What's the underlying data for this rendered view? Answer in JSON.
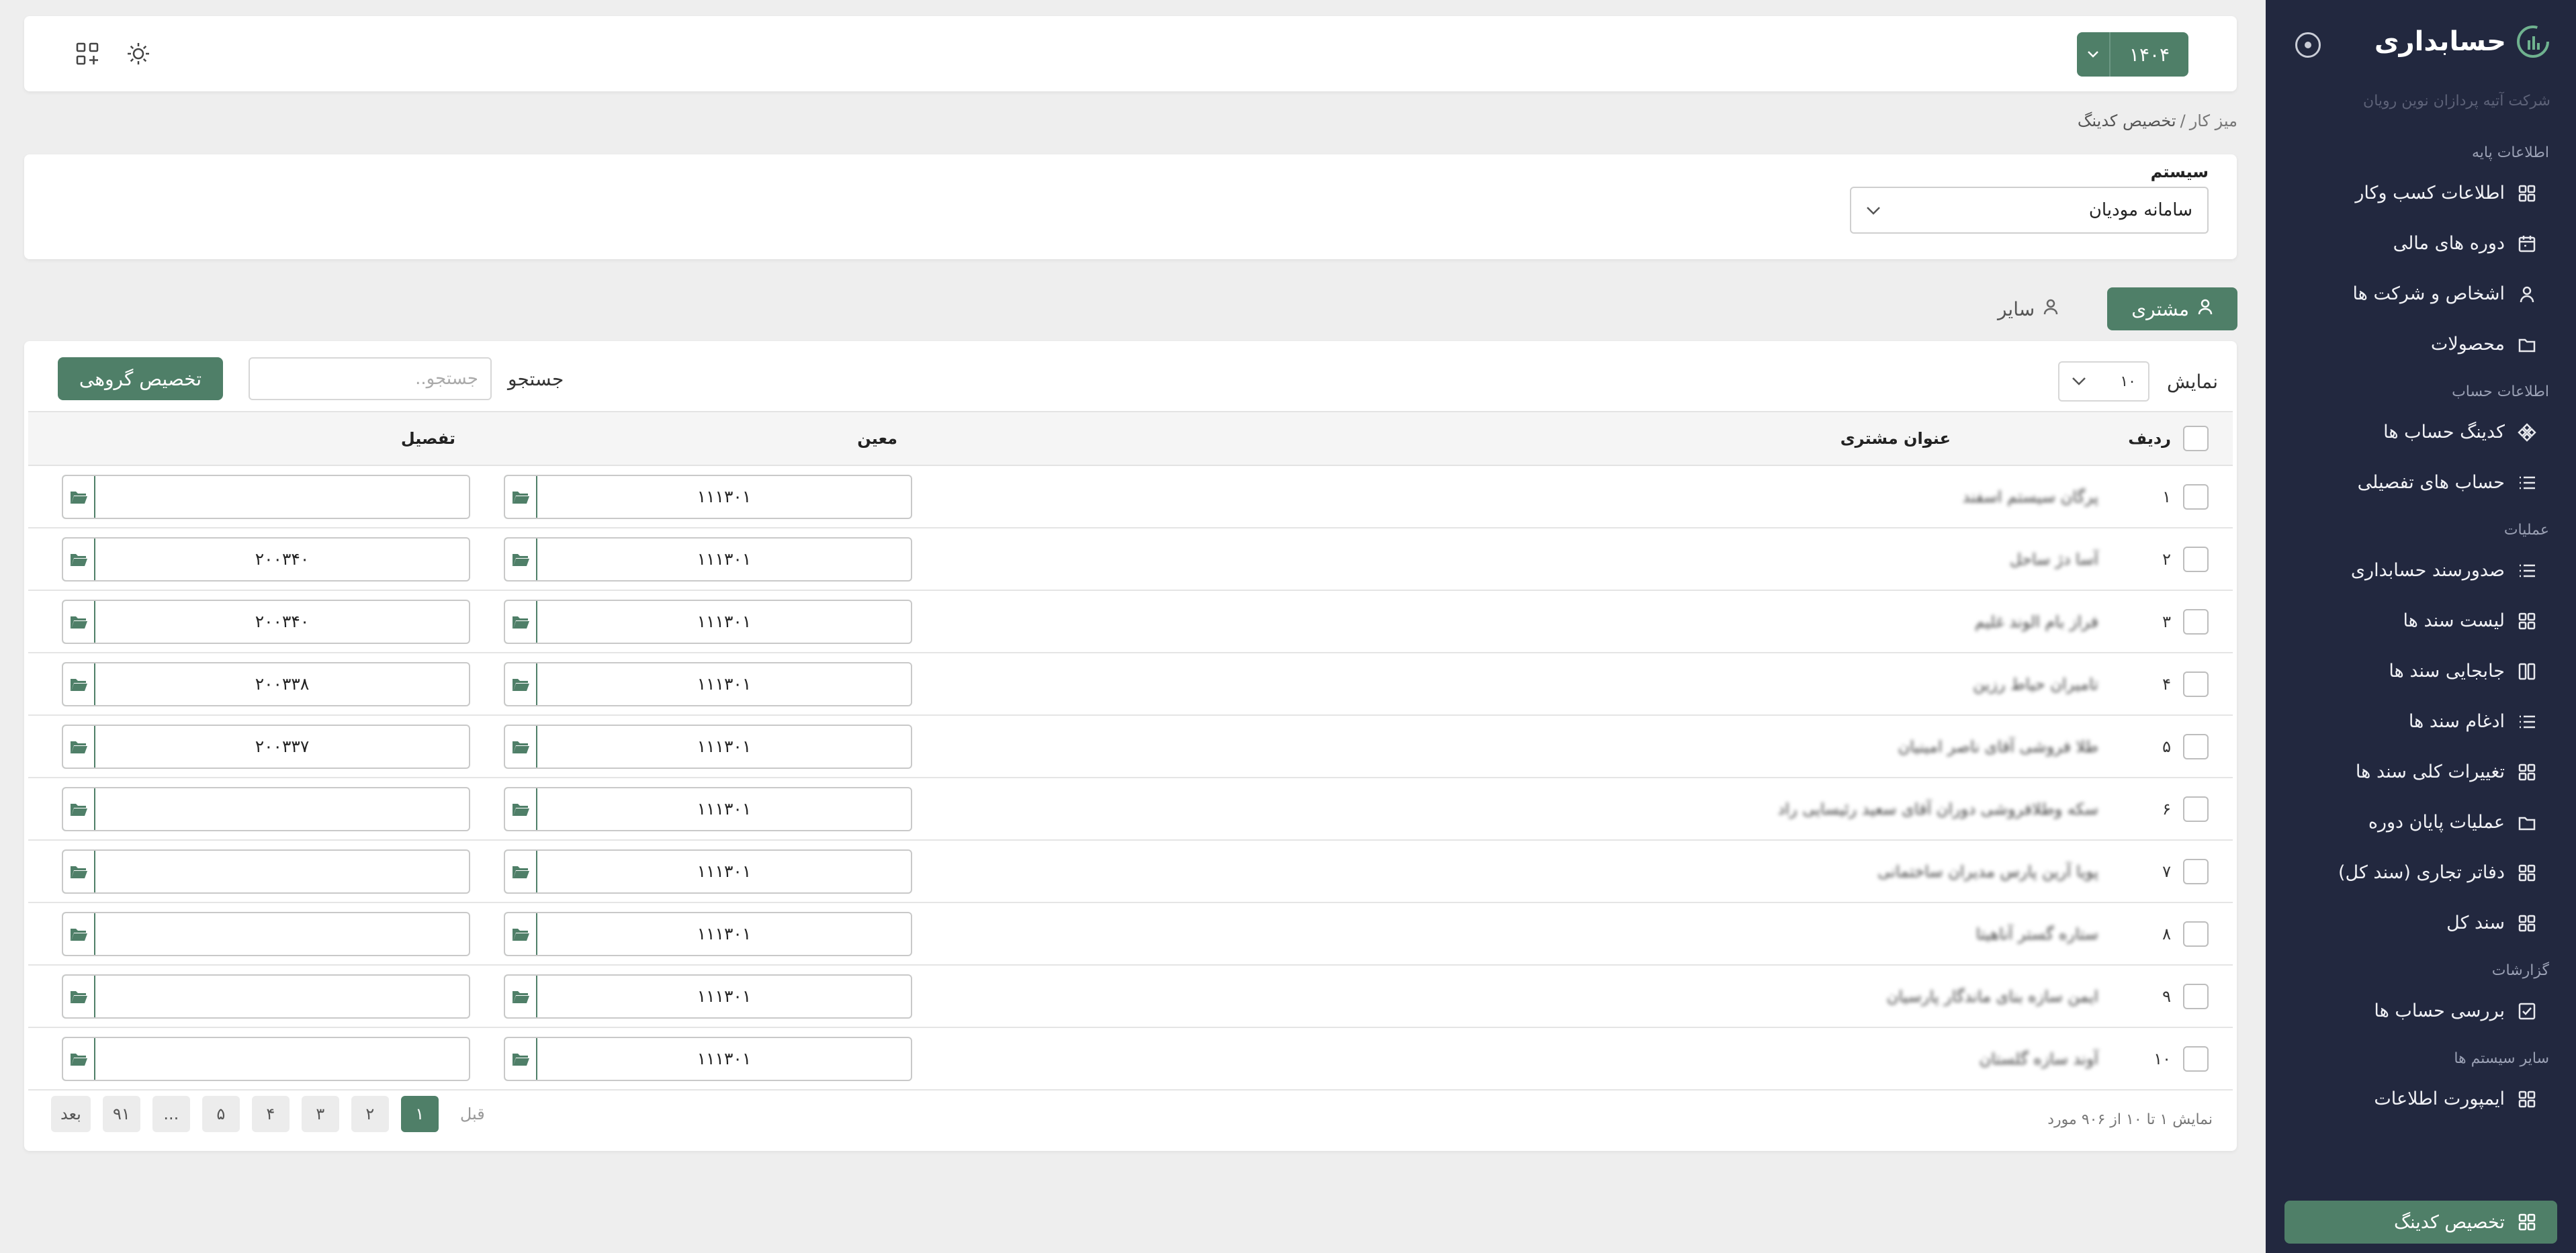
{
  "sidebar": {
    "title": "حسابداری",
    "company": "شرکت آتیه پردازان نوین رویان",
    "sections": [
      {
        "title": "اطلاعات پایه",
        "items": [
          {
            "label": "اطلاعات کسب وکار",
            "icon": "grid-icon"
          },
          {
            "label": "دوره های مالی",
            "icon": "calendar-icon"
          },
          {
            "label": "اشخاص و شرکت ها",
            "icon": "user-icon"
          },
          {
            "label": "محصولات",
            "icon": "folder-icon"
          }
        ]
      },
      {
        "title": "اطلاعات حساب",
        "items": [
          {
            "label": "کدینگ حساب ها",
            "icon": "diamond-icon"
          },
          {
            "label": "حساب های تفصیلی",
            "icon": "list-icon"
          }
        ]
      },
      {
        "title": "عملیات",
        "items": [
          {
            "label": "صدورسند حسابداری",
            "icon": "list-icon"
          },
          {
            "label": "لیست سند ها",
            "icon": "grid-icon"
          },
          {
            "label": "جابجایی سند ها",
            "icon": "columns-icon"
          },
          {
            "label": "ادغام سند ها",
            "icon": "list-icon"
          },
          {
            "label": "تغییرات کلی سند ها",
            "icon": "grid-icon"
          },
          {
            "label": "عملیات پایان دوره",
            "icon": "folder-icon"
          },
          {
            "label": "دفاتر تجاری (سند کل)",
            "icon": "grid-icon"
          },
          {
            "label": "سند کل",
            "icon": "grid-icon"
          }
        ]
      },
      {
        "title": "گزارشات",
        "items": [
          {
            "label": "بررسی حساب ها",
            "icon": "checkbox-icon"
          }
        ]
      },
      {
        "title": "سایر سیستم ها",
        "items": [
          {
            "label": "ایمپورت اطلاعات",
            "icon": "grid-icon"
          }
        ]
      }
    ],
    "active_item": {
      "label": "تخصیص کدینگ",
      "icon": "grid-icon"
    }
  },
  "topbar": {
    "year": "۱۴۰۴"
  },
  "breadcrumb": {
    "home": "میز کار",
    "separator": "/",
    "current": "تخصیص کدینگ"
  },
  "system": {
    "label": "سیستم",
    "value": "سامانه مودیان"
  },
  "tabs": [
    {
      "label": "مشتری",
      "active": true
    },
    {
      "label": "سایر",
      "active": false
    }
  ],
  "toolbar": {
    "show_label": "نمایش",
    "page_size": "۱۰",
    "search_label": "جستجو",
    "search_placeholder": "جستجو..",
    "group_assign": "تخصیص گروهی"
  },
  "table": {
    "headers": {
      "row": "ردیف",
      "title": "عنوان مشتری",
      "moein": "معین",
      "tafsil": "تفصیل"
    },
    "rows": [
      {
        "row": "۱",
        "title": "پرگان سیستم اسفند",
        "moein": "۱۱۱۳۰۱",
        "tafsil": ""
      },
      {
        "row": "۲",
        "title": "آسا دژ ساحل",
        "moein": "۱۱۱۳۰۱",
        "tafsil": "۲۰۰۳۴۰"
      },
      {
        "row": "۳",
        "title": "فراز بام الوند غلیم",
        "moein": "۱۱۱۳۰۱",
        "tafsil": "۲۰۰۳۴۰"
      },
      {
        "row": "۴",
        "title": "تامیران حیاط رزین",
        "moein": "۱۱۱۳۰۱",
        "tafsil": "۲۰۰۳۳۸"
      },
      {
        "row": "۵",
        "title": "طلا فروشی آقای ناصر امینیان",
        "moein": "۱۱۱۳۰۱",
        "tafsil": "۲۰۰۳۳۷"
      },
      {
        "row": "۶",
        "title": "سکه وطلافروشی دوران آقای سعید رئیسایی راد",
        "moein": "۱۱۱۳۰۱",
        "tafsil": ""
      },
      {
        "row": "۷",
        "title": "پویا آرین پارس مدیران ساختمانی",
        "moein": "۱۱۱۳۰۱",
        "tafsil": ""
      },
      {
        "row": "۸",
        "title": "ستاره گستر آناهیتا",
        "moein": "۱۱۱۳۰۱",
        "tafsil": ""
      },
      {
        "row": "۹",
        "title": "ایمن سازه بنای ماندگار پارسیان",
        "moein": "۱۱۱۳۰۱",
        "tafsil": ""
      },
      {
        "row": "۱۰",
        "title": "آوند سازه گلستان",
        "moein": "۱۱۱۳۰۱",
        "tafsil": ""
      }
    ]
  },
  "pagination": {
    "info": "نمایش ۱ تا ۱۰ از ۹۰۶ مورد",
    "prev": "قبل",
    "pages": [
      "۱",
      "۲",
      "۳",
      "۴",
      "۵",
      "...",
      "۹۱"
    ],
    "next": "بعد",
    "current": "۱"
  },
  "colors": {
    "accent": "#4f7f68",
    "sidebar_bg": "#22283f",
    "page_bg": "#eeeeee"
  }
}
